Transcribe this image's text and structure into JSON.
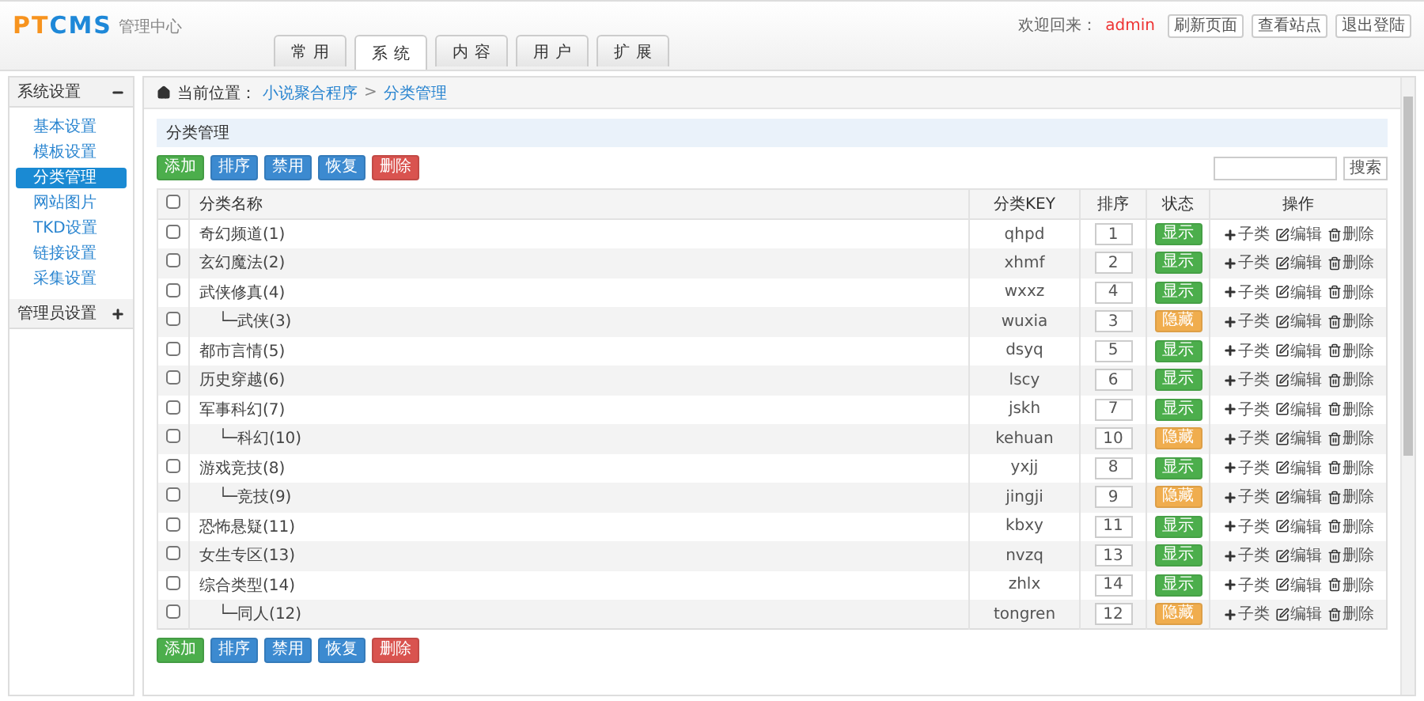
{
  "header": {
    "logo": {
      "prefix": "PT",
      "name": "CMS",
      "subtitle": "管理中心"
    },
    "tabs": [
      {
        "label": "常用",
        "selected": false
      },
      {
        "label": "系统",
        "selected": true
      },
      {
        "label": "内容",
        "selected": false
      },
      {
        "label": "用户",
        "selected": false
      },
      {
        "label": "扩展",
        "selected": false
      }
    ],
    "welcome": "欢迎回来：",
    "user": "admin",
    "buttons": [
      "刷新页面",
      "查看站点",
      "退出登陆"
    ]
  },
  "sidebar": {
    "groups": [
      {
        "title": "系统设置",
        "expanded": true,
        "items": [
          {
            "label": "基本设置",
            "selected": false
          },
          {
            "label": "模板设置",
            "selected": false
          },
          {
            "label": "分类管理",
            "selected": true
          },
          {
            "label": "网站图片",
            "selected": false
          },
          {
            "label": "TKD设置",
            "selected": false
          },
          {
            "label": "链接设置",
            "selected": false
          },
          {
            "label": "采集设置",
            "selected": false
          }
        ]
      },
      {
        "title": "管理员设置",
        "expanded": false
      }
    ]
  },
  "breadcrumb": {
    "label": "当前位置：",
    "path": [
      "小说聚合程序",
      "分类管理"
    ],
    "separator": ">"
  },
  "panel_title": "分类管理",
  "toolbar_top": [
    {
      "label": "添加",
      "kind": "success"
    },
    {
      "label": "排序",
      "kind": "primary"
    },
    {
      "label": "禁用",
      "kind": "primary"
    },
    {
      "label": "恢复",
      "kind": "primary"
    },
    {
      "label": "删除",
      "kind": "danger"
    }
  ],
  "search": {
    "button": "搜索"
  },
  "table": {
    "select_all": false,
    "columns": [
      "分类名称",
      "分类KEY",
      "排序",
      "状态",
      "操作"
    ],
    "rows": [
      {
        "name": "奇幻频道(1)",
        "key": "qhpd",
        "order": "1",
        "status": {
          "label": "显示",
          "kind": "shown"
        },
        "checked": false,
        "actions": [
          "子类",
          "编辑",
          "删除"
        ]
      },
      {
        "name": "玄幻魔法(2)",
        "key": "xhmf",
        "order": "2",
        "status": {
          "label": "显示",
          "kind": "shown"
        },
        "checked": false,
        "actions": [
          "子类",
          "编辑",
          "删除"
        ]
      },
      {
        "name": "武侠修真(4)",
        "key": "wxxz",
        "order": "4",
        "status": {
          "label": "显示",
          "kind": "shown"
        },
        "checked": false,
        "actions": [
          "子类",
          "编辑",
          "删除"
        ],
        "children": [
          {
            "name": "└─武侠(3)",
            "key": "wuxia",
            "order": "3",
            "status": {
              "label": "隐藏",
              "kind": "hidden"
            },
            "checked": false,
            "actions": [
              "子类",
              "编辑",
              "删除"
            ]
          }
        ]
      },
      {
        "name": "都市言情(5)",
        "key": "dsyq",
        "order": "5",
        "status": {
          "label": "显示",
          "kind": "shown"
        },
        "checked": false,
        "actions": [
          "子类",
          "编辑",
          "删除"
        ]
      },
      {
        "name": "历史穿越(6)",
        "key": "lscy",
        "order": "6",
        "status": {
          "label": "显示",
          "kind": "shown"
        },
        "checked": false,
        "actions": [
          "子类",
          "编辑",
          "删除"
        ]
      },
      {
        "name": "军事科幻(7)",
        "key": "jskh",
        "order": "7",
        "status": {
          "label": "显示",
          "kind": "shown"
        },
        "checked": false,
        "actions": [
          "子类",
          "编辑",
          "删除"
        ],
        "children": [
          {
            "name": "└─科幻(10)",
            "key": "kehuan",
            "order": "10",
            "status": {
              "label": "隐藏",
              "kind": "hidden"
            },
            "checked": false,
            "actions": [
              "子类",
              "编辑",
              "删除"
            ]
          }
        ]
      },
      {
        "name": "游戏竞技(8)",
        "key": "yxjj",
        "order": "8",
        "status": {
          "label": "显示",
          "kind": "shown"
        },
        "checked": false,
        "actions": [
          "子类",
          "编辑",
          "删除"
        ],
        "children": [
          {
            "name": "└─竞技(9)",
            "key": "jingji",
            "order": "9",
            "status": {
              "label": "隐藏",
              "kind": "hidden"
            },
            "checked": false,
            "actions": [
              "子类",
              "编辑",
              "删除"
            ]
          }
        ]
      },
      {
        "name": "恐怖悬疑(11)",
        "key": "kbxy",
        "order": "11",
        "status": {
          "label": "显示",
          "kind": "shown"
        },
        "checked": false,
        "actions": [
          "子类",
          "编辑",
          "删除"
        ]
      },
      {
        "name": "女生专区(13)",
        "key": "nvzq",
        "order": "13",
        "status": {
          "label": "显示",
          "kind": "shown"
        },
        "checked": false,
        "actions": [
          "子类",
          "编辑",
          "删除"
        ]
      },
      {
        "name": "综合类型(14)",
        "key": "zhlx",
        "order": "14",
        "status": {
          "label": "显示",
          "kind": "shown"
        },
        "checked": false,
        "actions": [
          "子类",
          "编辑",
          "删除"
        ],
        "children": [
          {
            "name": "└─同人(12)",
            "key": "tongren",
            "order": "12",
            "status": {
              "label": "隐藏",
              "kind": "hidden"
            },
            "checked": false,
            "actions": [
              "子类",
              "编辑",
              "删除"
            ]
          }
        ]
      }
    ]
  },
  "toolbar_bottom": [
    {
      "label": "添加",
      "kind": "success"
    },
    {
      "label": "排序",
      "kind": "primary"
    },
    {
      "label": "禁用",
      "kind": "primary"
    },
    {
      "label": "恢复",
      "kind": "primary"
    },
    {
      "label": "删除",
      "kind": "danger"
    }
  ]
}
